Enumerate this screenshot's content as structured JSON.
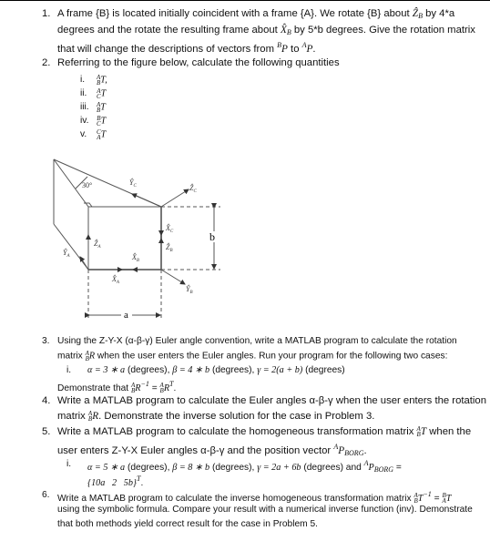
{
  "p1": {
    "num": "1.",
    "l1a": "A frame {B} is located initially coincident with a frame {A}. We rotate {B} about ",
    "zb": "Ẑ",
    "zbs": "B",
    "l1b": " by 4*a",
    "l2a": "degrees and the rotate the resulting frame about ",
    "xb": "X̂",
    "xbs": "B",
    "l2b": " by 5*b degrees. Give the rotation matrix",
    "l3a": "that will change the descriptions of vectors from ",
    "bp_sup": "B",
    "bp": "P",
    "l3b": " to ",
    "ap_sup": "A",
    "ap": "P",
    "l3c": "."
  },
  "p2": {
    "num": "2.",
    "text": "Referring to the figure below, calculate the following quantities",
    "items": [
      {
        "n": "i.",
        "sup": "A",
        "sub": "B",
        "m": "T",
        "tail": ","
      },
      {
        "n": "ii.",
        "sup": "A",
        "sub": "C",
        "m": "T",
        "tail": ""
      },
      {
        "n": "iii.",
        "sup": "A",
        "sub": "B",
        "m": "T",
        "tail": ""
      },
      {
        "n": "iv.",
        "sup": "B",
        "sub": "C",
        "m": "T",
        "tail": ""
      },
      {
        "n": "v.",
        "sup": "C",
        "sub": "A",
        "m": "T",
        "tail": ""
      }
    ]
  },
  "figure": {
    "angle": "30°",
    "yc": "Ŷ",
    "ycs": "C",
    "zc": "Ẑ",
    "zcs": "C",
    "xc": "X̂",
    "xcs": "C",
    "za": "Ẑ",
    "zas": "A",
    "zb": "Ẑ",
    "zbs": "B",
    "ya": "Ŷ",
    "yas": "A",
    "xb": "X̂",
    "xbs": "B",
    "xa": "X̂",
    "xas": "A",
    "yb": "Ŷ",
    "ybs": "B",
    "a": "a",
    "b": "b"
  },
  "p3": {
    "num": "3.",
    "l1": "Using the Z-Y-X (α-β-γ) Euler angle convention, write a MATLAB program to calculate the rotation",
    "l2a": "matrix ",
    "sup": "A",
    "sub": "B",
    "m": "R",
    "l2b": " when the user enters the Euler angles. Run your program for the following two cases:",
    "case_n": "i.",
    "c1": "α = 3 ∗ a",
    "c2": " (degrees), ",
    "c3": "β = 4 ∗ b",
    "c4": " (degrees), ",
    "c5": "γ = 2(a + b)",
    "c6": " (degrees)",
    "d1": "Demonstrate that ",
    "d2": "R",
    "d3": "−1",
    "d4": " = ",
    "d5": "R",
    "d6": "T",
    "d7": "."
  },
  "p4": {
    "num": "4.",
    "l1": "Write a MATLAB program to calculate the Euler angles α-β-γ when the user enters the rotation",
    "l2a": "matrix ",
    "sup": "A",
    "sub": "B",
    "m": "R",
    "l2b": ". Demonstrate the inverse solution for the case in Problem 3."
  },
  "p5": {
    "num": "5.",
    "l1a": "Write a MATLAB program to calculate the homogeneous transformation matrix ",
    "sup": "A",
    "sub": "B",
    "m": "T",
    "l1b": " when the",
    "l2a": "user enters Z-Y-X Euler angles α-β-γ and the position vector ",
    "psup": "A",
    "p": "P",
    "psub": "BORG",
    "l2b": ".",
    "case_n": "i.",
    "c1": "α = 5 ∗ a",
    "c2": " (degrees), ",
    "c3": "β = 8 ∗ b",
    "c4": " (degrees), ",
    "c5": "γ = 2a + 6b",
    "c6": " (degrees) and ",
    "c7": "P",
    "c8": "BORG",
    "c9": " =",
    "vec": "{10a   2   5b}",
    "vecT": "T",
    "vecEnd": "."
  },
  "p6": {
    "num": "6.",
    "l1a": "Write a MATLAB program to calculate the inverse homogeneous transformation matrix ",
    "m1": "T",
    "e1": "−1",
    "eq": " = ",
    "m2": "T",
    "s1": "A",
    "b1": "B",
    "s2": "B",
    "b2": "A",
    "l2": "using the symbolic formula. Compare your result with a numerical inverse function (inv). Demonstrate",
    "l3": "that both methods yield correct result for the case in Problem 5."
  }
}
